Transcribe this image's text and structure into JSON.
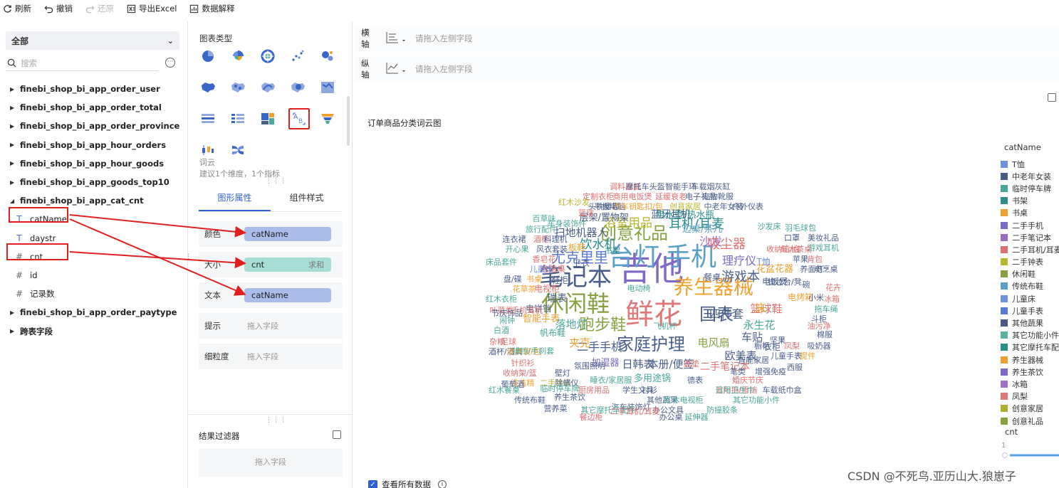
{
  "toolbar": {
    "refresh": "刷新",
    "undo": "撤销",
    "redo": "还原",
    "export": "导出Excel",
    "explain": "数据解释"
  },
  "left_panel": {
    "select_all": "全部",
    "search_placeholder": "搜索",
    "tables": [
      "finebi_shop_bi_app_order_user",
      "finebi_shop_bi_app_order_total",
      "finebi_shop_bi_app_order_province",
      "finebi_shop_bi_app_hour_orders",
      "finebi_shop_bi_app_hour_goods",
      "finebi_shop_bi_app_goods_top10",
      "finebi_shop_bi_app_cat_cnt"
    ],
    "fields": [
      "catName",
      "daystr",
      "cnt",
      "id",
      "记录数"
    ],
    "tables_after": [
      "finebi_shop_bi_app_order_paytype",
      "跨表字段"
    ]
  },
  "mid_panel": {
    "chart_type_title": "图表类型",
    "chart_name": "词云",
    "chart_hint": "建议1个维度，1个指标",
    "tab_graph": "图形属性",
    "tab_component": "组件样式",
    "props": {
      "color_label": "颜色",
      "color_value": "catName",
      "size_label": "大小",
      "size_value": "cnt",
      "size_agg": "求和",
      "text_label": "文本",
      "text_value": "catName",
      "tip_label": "提示",
      "tip_placeholder": "拖入字段",
      "granularity_label": "细粒度",
      "granularity_placeholder": "拖入字段"
    },
    "filter_title": "结果过滤器",
    "filter_placeholder": "拖入字段"
  },
  "axes": {
    "x_label": "横轴",
    "y_label": "纵轴",
    "placeholder": "请拖入左侧字段"
  },
  "chart_title": "订单商品分类词云图",
  "legend": {
    "title": "catName",
    "items": [
      {
        "label": "T恤",
        "color": "#6f8fe0"
      },
      {
        "label": "中老年女装",
        "color": "#4a5e8c"
      },
      {
        "label": "临时停车牌",
        "color": "#4aa89a"
      },
      {
        "label": "书架",
        "color": "#2a8c8c"
      },
      {
        "label": "书桌",
        "color": "#f0a030"
      },
      {
        "label": "二手手机",
        "color": "#7a6cc8"
      },
      {
        "label": "二手笔记本",
        "color": "#9a6cc0"
      },
      {
        "label": "二手耳机/耳麦",
        "color": "#e07070"
      },
      {
        "label": "二手钟表",
        "color": "#b8b830"
      },
      {
        "label": "休闲鞋",
        "color": "#88a040"
      },
      {
        "label": "传统布鞋",
        "color": "#5aa0c8"
      },
      {
        "label": "儿童床",
        "color": "#7090e0"
      },
      {
        "label": "儿童手表",
        "color": "#5a78d8"
      },
      {
        "label": "其他蔬果",
        "color": "#4a5a88"
      },
      {
        "label": "其它功能小件",
        "color": "#58b0a0"
      },
      {
        "label": "其它摩托车配件",
        "color": "#2a8c8c"
      },
      {
        "label": "养生器械",
        "color": "#f0a030"
      },
      {
        "label": "养生茶饮",
        "color": "#8068c8"
      },
      {
        "label": "冰箱",
        "color": "#a070c8"
      },
      {
        "label": "凤梨",
        "color": "#e07878"
      },
      {
        "label": "创意家居",
        "color": "#b0b030"
      },
      {
        "label": "创意礼品",
        "color": "#88a040"
      }
    ],
    "cnt_title": "cnt",
    "cnt_min": "1"
  },
  "chart_data": {
    "type": "wordcloud",
    "words": [
      {
        "text": "吉他",
        "color": "#8068c8"
      },
      {
        "text": "台灯",
        "color": "#5aa0c8"
      },
      {
        "text": "手机",
        "color": "#5aa0c8"
      },
      {
        "text": "鲜花",
        "color": "#e07878"
      },
      {
        "text": "笔记本",
        "color": "#4a5e8c"
      },
      {
        "text": "休闲鞋",
        "color": "#88a040"
      },
      {
        "text": "养生器械",
        "color": "#f0a030"
      },
      {
        "text": "家庭护理",
        "color": "#4a5e8c"
      },
      {
        "text": "创意礼品",
        "color": "#88a040"
      },
      {
        "text": "国表",
        "color": "#4a5e8c"
      },
      {
        "text": "跑步鞋",
        "color": "#88a040"
      },
      {
        "text": "尤克里里",
        "color": "#5a78d8"
      },
      {
        "text": "游戏本",
        "color": "#4a5e8c"
      },
      {
        "text": "耳机/耳麦",
        "color": "#2a8c8c"
      },
      {
        "text": "沙发",
        "color": "#9a6cc0"
      },
      {
        "text": "吸尘器",
        "color": "#e07070"
      },
      {
        "text": "饮水机",
        "color": "#2a8c8c"
      },
      {
        "text": "浴室用品",
        "color": "#b8b830"
      },
      {
        "text": "扫地机器人",
        "color": "#4a5e8c"
      },
      {
        "text": "理疗仪",
        "color": "#7a6cc8"
      },
      {
        "text": "四件套",
        "color": "#4a5e8c"
      },
      {
        "text": "永生花",
        "color": "#4aa89a"
      },
      {
        "text": "篮球鞋",
        "color": "#e07070"
      },
      {
        "text": "二手手机",
        "color": "#4a5e8c"
      },
      {
        "text": "日韩表",
        "color": "#4a5e8c"
      },
      {
        "text": "本册/便签",
        "color": "#4a5e8c"
      },
      {
        "text": "电风扇",
        "color": "#88a040"
      },
      {
        "text": "欧美表",
        "color": "#4a5e8c"
      },
      {
        "text": "车贴",
        "color": "#4a5e8c"
      },
      {
        "text": "床",
        "color": "#f0a030"
      },
      {
        "text": "落地灯",
        "color": "#4aa89a"
      },
      {
        "text": "夹克",
        "color": "#f0a030"
      },
      {
        "text": "多用途锅",
        "color": "#4aa89a"
      },
      {
        "text": "二手笔记本",
        "color": "#e07070"
      },
      {
        "text": "加湿器",
        "color": "#7a6cc8"
      },
      {
        "text": "瑞表",
        "color": "#4a5e8c"
      },
      {
        "text": "智能手表",
        "color": "#f0a030"
      },
      {
        "text": "蓝牙耳机",
        "color": "#4a5e8c"
      },
      {
        "text": "电水壶/热水瓶",
        "color": "#2a8c8c"
      },
      {
        "text": "边桌/茶几",
        "color": "#5aa0c8"
      },
      {
        "text": "层架/置物架",
        "color": "#4a5e8c"
      },
      {
        "text": "电脑桌",
        "color": "#e07070"
      },
      {
        "text": "板鞋",
        "color": "#f0a030"
      },
      {
        "text": "鞋柜",
        "color": "#4a5e8c"
      },
      {
        "text": "卫衣",
        "color": "#4a5e8c"
      },
      {
        "text": "电视柜",
        "color": "#e07070"
      },
      {
        "text": "电饼铛",
        "color": "#4a5e8c"
      },
      {
        "text": "餐桌",
        "color": "#4a5e8c"
      },
      {
        "text": "花盆花器",
        "color": "#f0a030"
      },
      {
        "text": "电饭煲",
        "color": "#4a5e8c"
      },
      {
        "text": "T恤",
        "color": "#7090e0"
      },
      {
        "text": "收纳箱/盒",
        "color": "#e07070"
      },
      {
        "text": "红木茶桌",
        "color": "#e07070"
      },
      {
        "text": "电烤箱",
        "color": "#f0a030"
      },
      {
        "text": "衣柜",
        "color": "#4a5e8c"
      },
      {
        "text": "睡衣/家居服",
        "color": "#4aa89a"
      },
      {
        "text": "学生文具",
        "color": "#4a5e8c"
      },
      {
        "text": "帆布鞋",
        "color": "#4aa89a"
      },
      {
        "text": "氛围照明",
        "color": "#4a5e8c"
      },
      {
        "text": "智能家居",
        "color": "#4a5e8c"
      },
      {
        "text": "手机耳机",
        "color": "#e07070"
      },
      {
        "text": "头枕腰靠",
        "color": "#4a5e8c"
      },
      {
        "text": "平板电脑",
        "color": "#4a5e8c"
      },
      {
        "text": "汽车钥匙扣/包",
        "color": "#f0a030"
      },
      {
        "text": "创意家居",
        "color": "#b8b830"
      },
      {
        "text": "中老年女装",
        "color": "#4a5e8c"
      },
      {
        "text": "户外仪表",
        "color": "#4a5e8c"
      },
      {
        "text": "定制衣柜",
        "color": "#e07070"
      },
      {
        "text": "商用电饭煲",
        "color": "#e07070"
      },
      {
        "text": "延缓衰老",
        "color": "#e07070"
      },
      {
        "text": "电子礼品",
        "color": "#4a5e8c"
      },
      {
        "text": "宠物靴服",
        "color": "#4a5e8c"
      },
      {
        "text": "调料器皿",
        "color": "#e07070"
      },
      {
        "text": "摩托车头盔",
        "color": "#4a5e8c"
      },
      {
        "text": "智能手环",
        "color": "#4a5e8c"
      },
      {
        "text": "车载烟灰缸",
        "color": "#4a5e8c"
      },
      {
        "text": "红木沙发",
        "color": "#b8b830"
      },
      {
        "text": "百草味",
        "color": "#4aa89a"
      },
      {
        "text": "车身装饰件",
        "color": "#4aa89a"
      },
      {
        "text": "旅行配件",
        "color": "#4aa89a"
      },
      {
        "text": "连衣裙",
        "color": "#4a5e8c"
      },
      {
        "text": "酒柜",
        "color": "#e07070"
      },
      {
        "text": "料理机",
        "color": "#4a5e8c"
      },
      {
        "text": "开心果",
        "color": "#4aa89a"
      },
      {
        "text": "风衣",
        "color": "#4a5e8c"
      },
      {
        "text": "套装",
        "color": "#4a5e8c"
      },
      {
        "text": "床品套件",
        "color": "#4aa89a"
      },
      {
        "text": "香皂花",
        "color": "#e07070"
      },
      {
        "text": "儿童床",
        "color": "#7090e0"
      },
      {
        "text": "盘/碟",
        "color": "#4a5e8c"
      },
      {
        "text": "书桌",
        "color": "#f0a030"
      },
      {
        "text": "花草茶",
        "color": "#f0a030"
      },
      {
        "text": "红木衣柜",
        "color": "#4aa89a"
      },
      {
        "text": "叶菜类",
        "color": "#e07070"
      },
      {
        "text": "闹钟",
        "color": "#4aa89a"
      },
      {
        "text": "白酒",
        "color": "#4aa89a"
      },
      {
        "text": "杂粮",
        "color": "#e07070"
      },
      {
        "text": "足球",
        "color": "#e07070"
      },
      {
        "text": "酒杯/酒具",
        "color": "#4a5e8c"
      },
      {
        "text": "收纳袋/包",
        "color": "#f0a030"
      },
      {
        "text": "针织衫",
        "color": "#e07070"
      },
      {
        "text": "收纳架/篮",
        "color": "#e07070"
      },
      {
        "text": "壁灯",
        "color": "#4a5e8c"
      },
      {
        "text": "洗洁精",
        "color": "#f0a030"
      },
      {
        "text": "二手钟表",
        "color": "#b8b830"
      },
      {
        "text": "除螨仪",
        "color": "#4a5e8c"
      },
      {
        "text": "厨房用品",
        "color": "#e07070"
      },
      {
        "text": "衬衫",
        "color": "#4a5e8c"
      },
      {
        "text": "德表",
        "color": "#4a5e8c"
      },
      {
        "text": "遮阳挡/雪挡",
        "color": "#e07070"
      },
      {
        "text": "养生茶饮",
        "color": "#4a5e8c"
      },
      {
        "text": "汽车装饰灯",
        "color": "#4a5e8c"
      },
      {
        "text": "其他蔬果",
        "color": "#4a5e8c"
      },
      {
        "text": "红木电视柜",
        "color": "#4aa89a"
      },
      {
        "text": "办公文具",
        "color": "#4a5e8c"
      },
      {
        "text": "其它摩托车配件",
        "color": "#4aa89a"
      },
      {
        "text": "二手耳机/耳麦",
        "color": "#e07070"
      },
      {
        "text": "办公桌",
        "color": "#4a5e8c"
      },
      {
        "text": "延伸器",
        "color": "#4aa89a"
      },
      {
        "text": "防撞胶条",
        "color": "#4aa89a"
      },
      {
        "text": "日用卫生巾",
        "color": "#4aa89a"
      },
      {
        "text": "其它功能小件",
        "color": "#4aa89a"
      },
      {
        "text": "车载纸巾盒",
        "color": "#4a5e8c"
      },
      {
        "text": "婚庆节庆",
        "color": "#e07070"
      },
      {
        "text": "增强免疫",
        "color": "#4a5e8c"
      },
      {
        "text": "西服",
        "color": "#4a5e8c"
      },
      {
        "text": "笔类",
        "color": "#4a5e8c"
      },
      {
        "text": "儿童手表",
        "color": "#4a5e8c"
      },
      {
        "text": "提件",
        "color": "#f0a030"
      },
      {
        "text": "吸奶器",
        "color": "#4a5e8c"
      },
      {
        "text": "棉服",
        "color": "#4a5e8c"
      },
      {
        "text": "橱柜",
        "color": "#4a5e8c"
      },
      {
        "text": "凤梨",
        "color": "#e07070"
      },
      {
        "text": "坚果",
        "color": "#4a5e8c"
      },
      {
        "text": "油污净",
        "color": "#e07070"
      },
      {
        "text": "斗柜",
        "color": "#4a5e8c"
      },
      {
        "text": "拖车绳",
        "color": "#4aa89a"
      },
      {
        "text": "冰箱",
        "color": "#e07070"
      },
      {
        "text": "小米",
        "color": "#4a5e8c"
      },
      {
        "text": "花卉",
        "color": "#e07070"
      },
      {
        "text": "碗",
        "color": "#4a5e8c"
      },
      {
        "text": "梳妆台/凳",
        "color": "#4a5e8c"
      },
      {
        "text": "养面灯",
        "color": "#4a5e8c"
      },
      {
        "text": "电烹桌",
        "color": "#4a5e8c"
      },
      {
        "text": "苹果",
        "color": "#4a5e8c"
      },
      {
        "text": "背包",
        "color": "#e07070"
      },
      {
        "text": "口罩",
        "color": "#4a5e8c"
      },
      {
        "text": "美妆礼品",
        "color": "#4a5e8c"
      },
      {
        "text": "游戏耳机",
        "color": "#4aa89a"
      },
      {
        "text": "羽毛球包",
        "color": "#4aa89a"
      },
      {
        "text": "沙发床",
        "color": "#4aa89a"
      },
      {
        "text": "葡萄酒",
        "color": "#4a5e8c"
      },
      {
        "text": "红木餐桌",
        "color": "#4aa89a"
      },
      {
        "text": "传统布鞋",
        "color": "#4a5e8c"
      },
      {
        "text": "营养菜",
        "color": "#4a5e8c"
      },
      {
        "text": "餐边柜",
        "color": "#e07070"
      },
      {
        "text": "节庆饰品",
        "color": "#4a5e8c"
      },
      {
        "text": "排挡/手刹套",
        "color": "#4aa89a"
      },
      {
        "text": "临时停车牌",
        "color": "#4aa89a"
      },
      {
        "text": "篮球",
        "color": "#e07070"
      },
      {
        "text": "书架",
        "color": "#2a8c8c"
      },
      {
        "text": "电动椅",
        "color": "#4aa89a"
      },
      {
        "text": "飞机杯",
        "color": "#4aa89a"
      },
      {
        "text": "座垫",
        "color": "#e07070"
      }
    ]
  },
  "footer": {
    "view_all": "查看所有数据"
  },
  "watermark": "CSDN @不死鸟.亚历山大.狼崽子"
}
